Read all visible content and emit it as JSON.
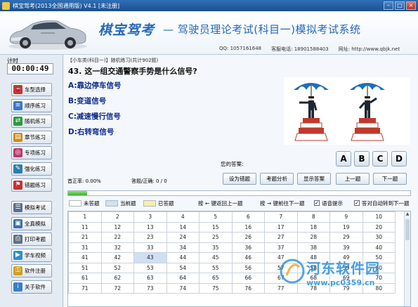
{
  "window": {
    "title": "棋宝驾考(2013全国通用版) V4.1 [未注册]",
    "controls": [
      "–",
      "□",
      "×"
    ]
  },
  "header": {
    "brand": "棋宝驾考",
    "subtitle": "— 驾驶员理论考试(科目一)模拟考试系统",
    "qq": "QQ: 1057161648",
    "phone": "客服电话: 18901588403",
    "website": "网址: http://www.qbjk.net"
  },
  "sidebar": {
    "timer_label": "计时",
    "timer_value": "00:00:49",
    "group1": [
      {
        "label": "车型选择",
        "icon": "car-icon",
        "color": "#c0392b"
      },
      {
        "label": "顺序练习",
        "icon": "list-icon",
        "color": "#3a78c2"
      },
      {
        "label": "随机练习",
        "icon": "shuffle-icon",
        "color": "#2e9a3c"
      },
      {
        "label": "章节练习",
        "icon": "book-icon",
        "color": "#d08a1a"
      },
      {
        "label": "专项练习",
        "icon": "target-icon",
        "color": "#b83a6a"
      },
      {
        "label": "强化练习",
        "icon": "edit-icon",
        "color": "#2d7fa8"
      },
      {
        "label": "错题练习",
        "icon": "flag-icon",
        "color": "#c63030"
      }
    ],
    "group2": [
      {
        "label": "模拟考试",
        "icon": "exam-icon",
        "color": "#5a6f8a"
      },
      {
        "label": "全真模拟",
        "icon": "monitor-icon",
        "color": "#3b6fb0"
      },
      {
        "label": "打印考题",
        "icon": "printer-icon",
        "color": "#607080"
      },
      {
        "label": "学车视频",
        "icon": "video-icon",
        "color": "#2f8ed0"
      },
      {
        "label": "软件注册",
        "icon": "key-icon",
        "color": "#d0a020"
      },
      {
        "label": "关于软件",
        "icon": "info-icon",
        "color": "#3a7ec8"
      }
    ]
  },
  "main": {
    "info": "【小车类(科目一)】随机练习(共计902题)",
    "question": "43. 这一组交通警察手势是什么信号?",
    "options": [
      "A:靠边停车信号",
      "B:变道信号",
      "C:减速慢行信号",
      "D:右转弯信号"
    ],
    "your_answer_label": "您的答案:",
    "answer_buttons": [
      "A",
      "B",
      "C",
      "D"
    ],
    "accuracy": "首正率: 0.00%",
    "answered": "答题/正确: 0 / 0",
    "actions": [
      "设为错题",
      "考题分析",
      "显示答案",
      "上一题",
      "下一题"
    ],
    "progress": 0.055,
    "legend": {
      "unanswered": "未答题",
      "current": "当前题",
      "answered": "已答题",
      "prev_hint": "按 ← 键返回上一题",
      "next_hint": "按 → 键前往下一题",
      "voice": "语音提示",
      "auto_next": "答对自动转到下一题"
    },
    "grid": [
      [
        "1",
        "2",
        "3",
        "4",
        "5",
        "6",
        "7",
        "8",
        "9",
        "10"
      ],
      [
        "11",
        "12",
        "13",
        "14",
        "15",
        "16",
        "17",
        "18",
        "19",
        "20"
      ],
      [
        "21",
        "22",
        "23",
        "24",
        "25",
        "26",
        "27",
        "28",
        "29",
        "30"
      ],
      [
        "31",
        "32",
        "33",
        "34",
        "35",
        "36",
        "37",
        "38",
        "39",
        "40"
      ],
      [
        "41",
        "42",
        "43",
        "44",
        "45",
        "46",
        "47",
        "48",
        "49",
        "50"
      ],
      [
        "51",
        "52",
        "53",
        "54",
        "55",
        "56",
        "57",
        "58",
        "59",
        "60"
      ],
      [
        "61",
        "62",
        "63",
        "64",
        "65",
        "66",
        "67",
        "68",
        "69",
        "70"
      ],
      [
        "71",
        "72",
        "73",
        "74",
        "75",
        "76",
        "77",
        "78",
        "79",
        "80"
      ]
    ],
    "current_question": "43"
  },
  "watermark": {
    "text": "河东软件园",
    "url": "www.pc0359.cn"
  }
}
